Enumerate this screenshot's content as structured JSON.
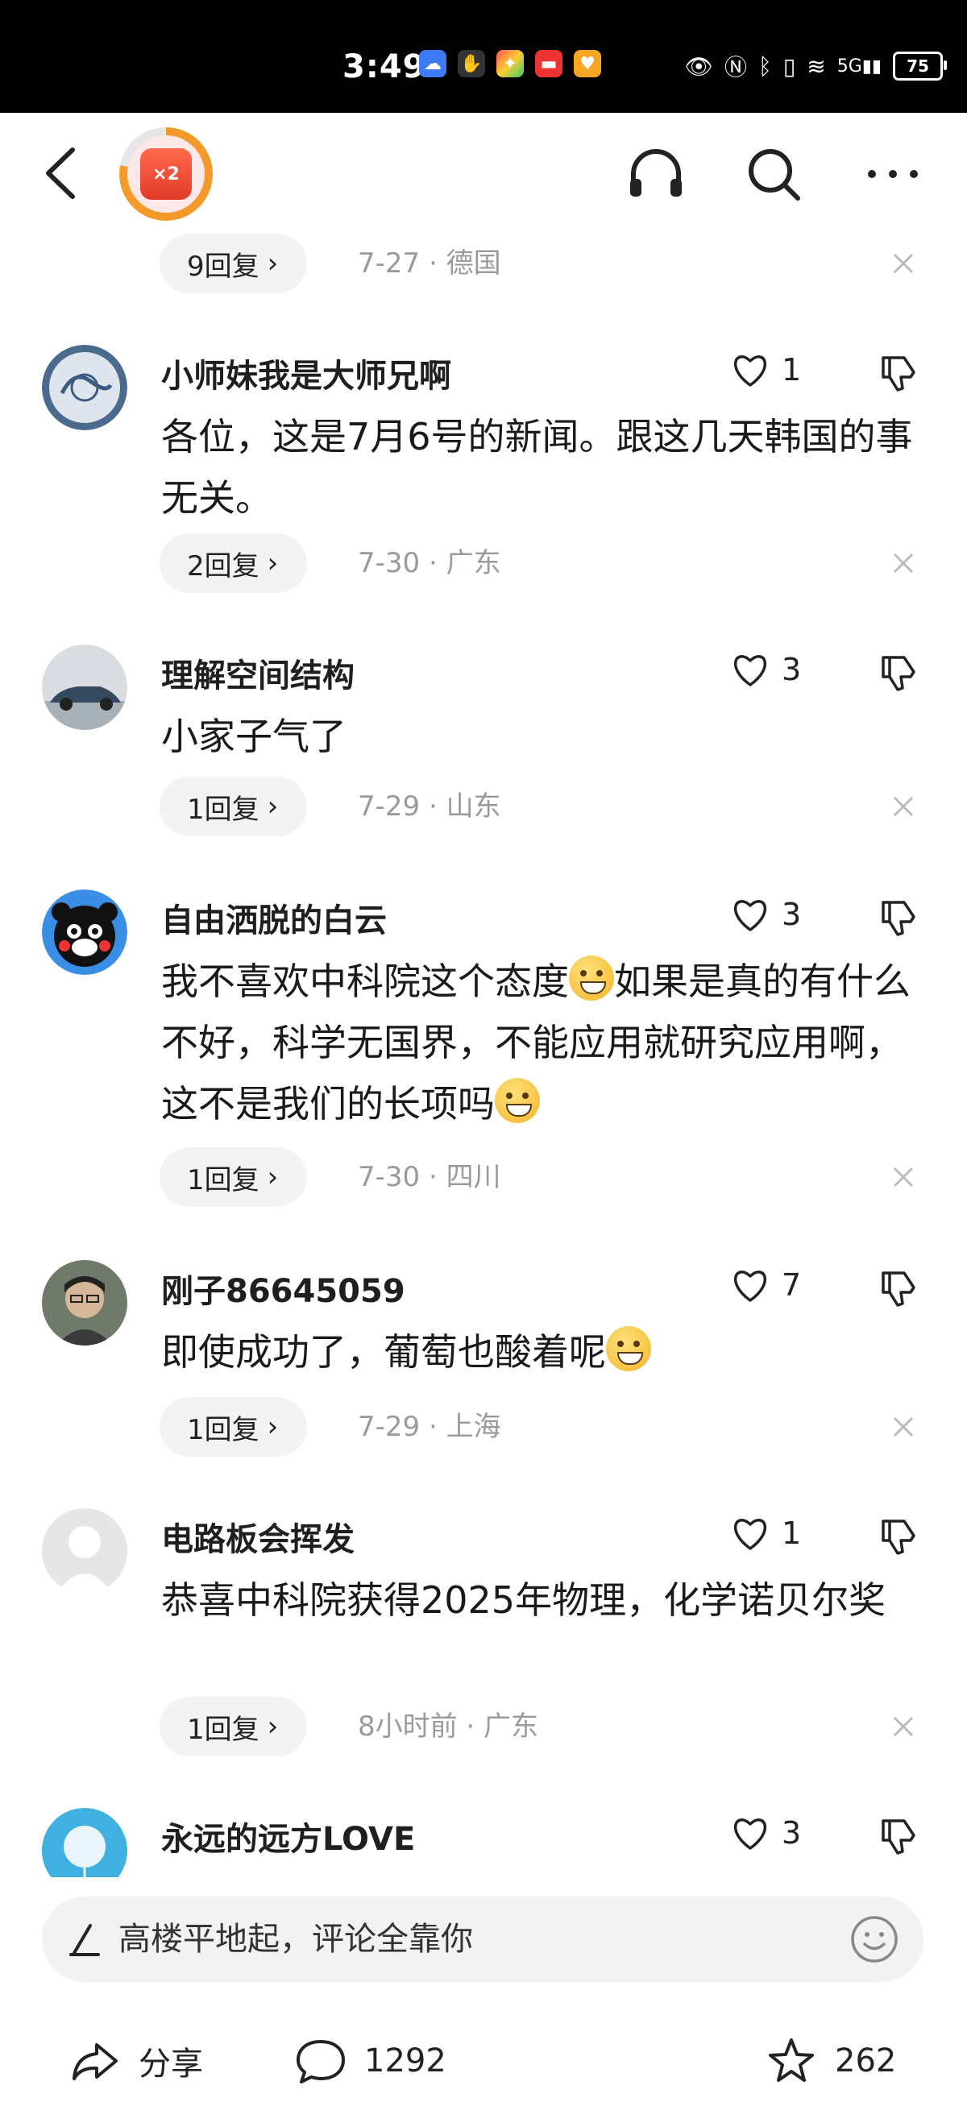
{
  "status_bar": {
    "time": "3:49",
    "battery": "75",
    "network": "5G"
  },
  "header": {
    "badge_text": "×2"
  },
  "top_reply": {
    "reply_label": "9回复",
    "meta": "7-27 · 德国"
  },
  "comments": [
    {
      "name": "小师妹我是大师兄啊",
      "likes": "1",
      "text": "各位，这是7月6号的新闻。跟这几天韩国的事无关。",
      "reply_label": "2回复",
      "meta": "7-30 · 广东",
      "avatar": "dragon-porcelain"
    },
    {
      "name": "理解空间结构",
      "likes": "3",
      "text": "小家子气了",
      "reply_label": "1回复",
      "meta": "7-29 · 山东",
      "avatar": "car"
    },
    {
      "name": "自由洒脱的白云",
      "likes": "3",
      "text_parts": [
        "我不喜欢中科院这个态度",
        "如果是真的有什么不好，科学无国界，不能应用就研究应用啊，这不是我们的长项吗"
      ],
      "reply_label": "1回复",
      "meta": "7-30 · 四川",
      "avatar": "kumamon"
    },
    {
      "name": "刚子86645059",
      "likes": "7",
      "text": "即使成功了，葡萄也酸着呢",
      "reply_label": "1回复",
      "meta": "7-29 · 上海",
      "avatar": "man-glasses"
    },
    {
      "name": "电路板会挥发",
      "likes": "1",
      "text": "恭喜中科院获得2025年物理，化学诺贝尔奖",
      "reply_label": "1回复",
      "meta": "8小时前 · 广东",
      "avatar": "default"
    },
    {
      "name": "永远的远方LOVE",
      "likes": "3",
      "avatar": "dandelion"
    }
  ],
  "input": {
    "placeholder": "高楼平地起，评论全靠你"
  },
  "bottom_bar": {
    "share_label": "分享",
    "comment_count": "1292",
    "favorite_count": "262"
  }
}
